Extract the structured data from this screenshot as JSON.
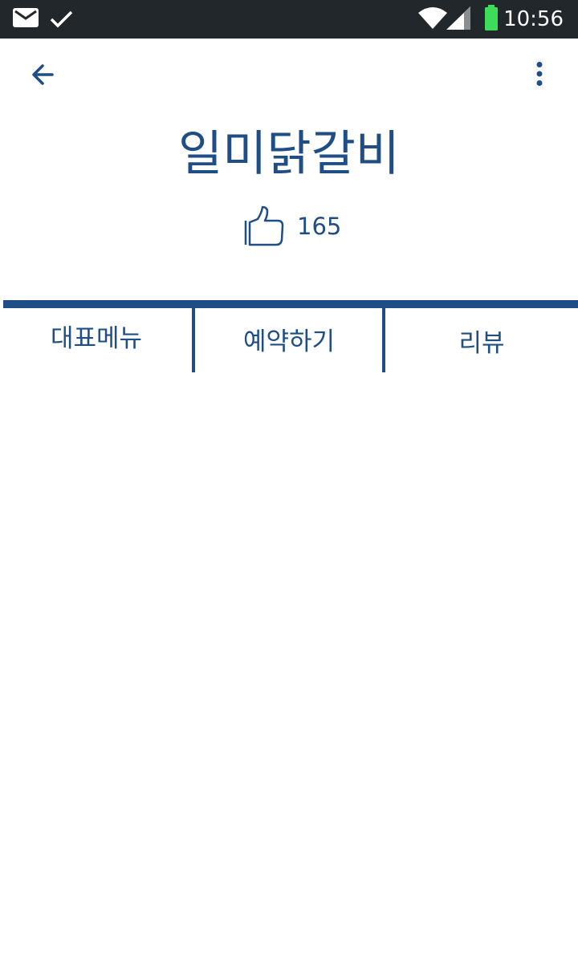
{
  "status_bar": {
    "time": "10:56",
    "icons": [
      "gmail-icon",
      "check-icon",
      "wifi-icon",
      "cell-signal-icon",
      "battery-icon"
    ],
    "battery_color": "#3ddc5a"
  },
  "toolbar": {
    "back_icon": "arrow-left-icon",
    "menu_icon": "more-vert-icon"
  },
  "restaurant": {
    "name": "일미닭갈비",
    "like_icon": "thumbs-up-icon",
    "like_count": "165"
  },
  "tabs": [
    {
      "label": "대표메뉴"
    },
    {
      "label": "예약하기"
    },
    {
      "label": "리뷰"
    }
  ],
  "colors": {
    "accent": "#1f4d85",
    "status_bar_bg": "#22272c",
    "background": "#ffffff"
  }
}
